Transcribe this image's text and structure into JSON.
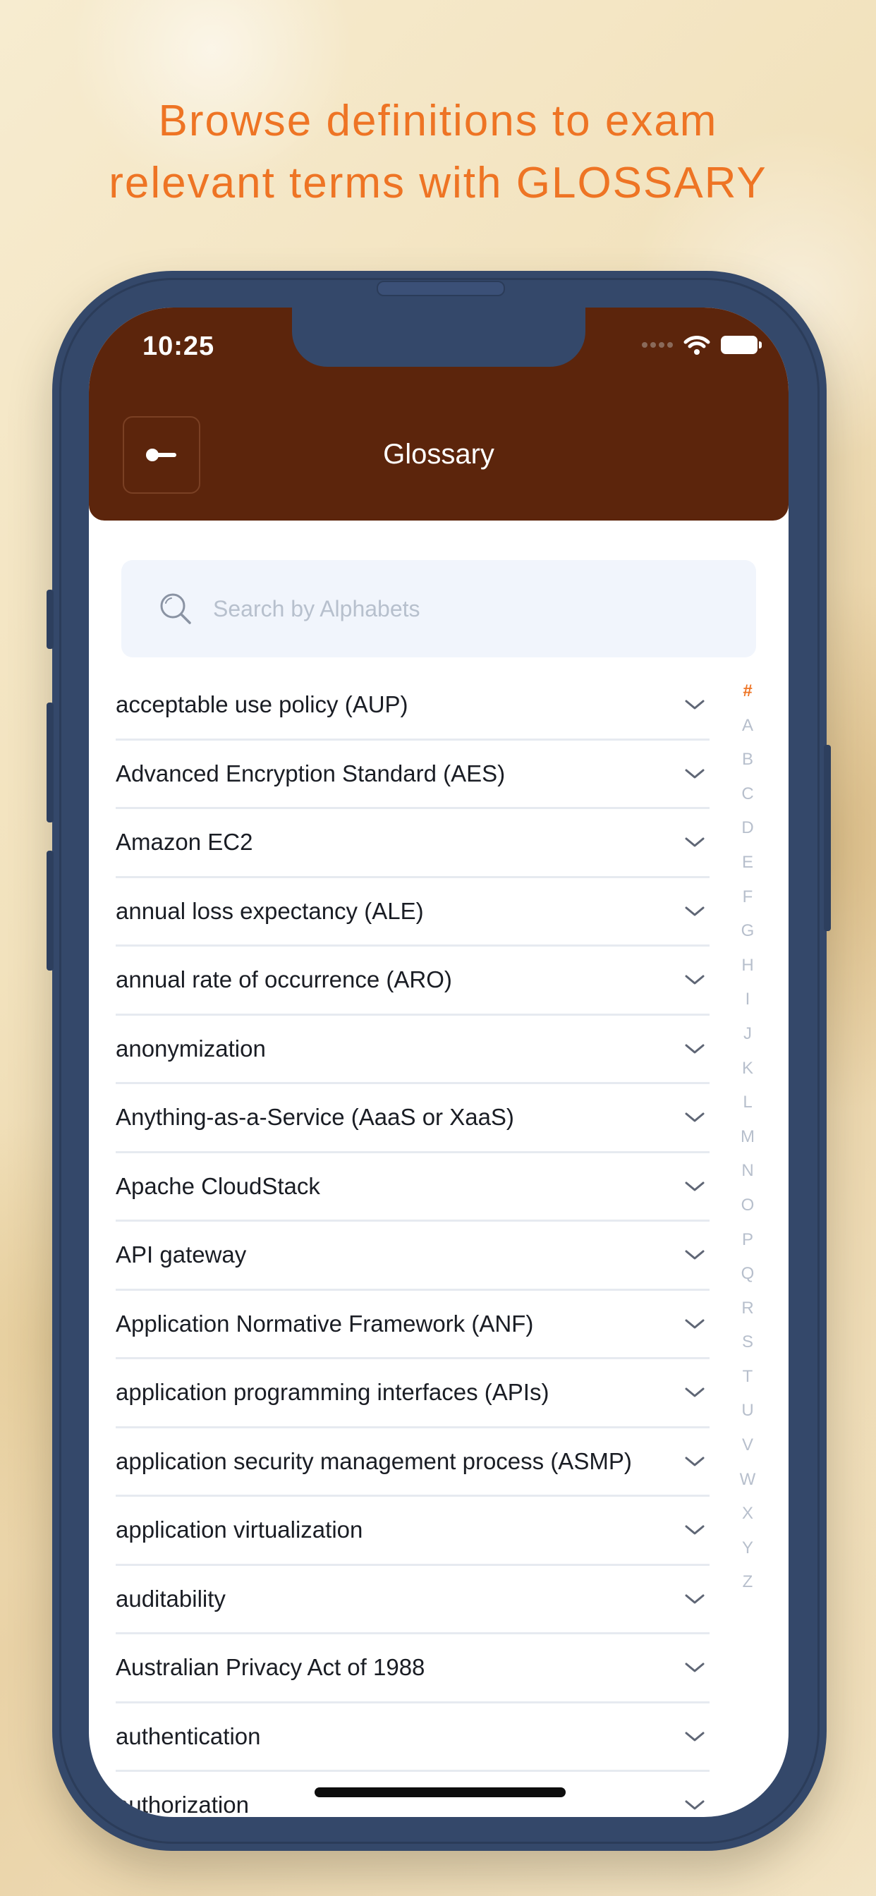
{
  "headline": {
    "line1": "Browse definitions to exam",
    "line2": "relevant terms with GLOSSARY"
  },
  "colors": {
    "accent": "#ee7424",
    "header_bg": "#5c250c",
    "phone_frame": "#34486a"
  },
  "status_bar": {
    "time": "10:25",
    "icons": [
      "cellular-signal-icon",
      "wifi-icon",
      "battery-icon"
    ]
  },
  "header": {
    "back_icon": "back-arrow-icon",
    "title": "Glossary"
  },
  "search": {
    "icon": "search-icon",
    "placeholder": "Search by Alphabets",
    "value": ""
  },
  "terms": [
    "acceptable use policy (AUP)",
    "Advanced Encryption Standard (AES)",
    "Amazon EC2",
    "annual loss expectancy (ALE)",
    "annual rate of occurrence (ARO)",
    "anonymization",
    "Anything-as-a-Service (AaaS or XaaS)",
    "Apache CloudStack",
    "API gateway",
    "Application Normative Framework (ANF)",
    "application programming interfaces (APIs)",
    "application security management process (ASMP)",
    "application virtualization",
    "auditability",
    "Australian Privacy Act of 1988",
    "authentication",
    "authorization"
  ],
  "alphabet_index": {
    "active": "#",
    "letters": [
      "#",
      "A",
      "B",
      "C",
      "D",
      "E",
      "F",
      "G",
      "H",
      "I",
      "J",
      "K",
      "L",
      "M",
      "N",
      "O",
      "P",
      "Q",
      "R",
      "S",
      "T",
      "U",
      "V",
      "W",
      "X",
      "Y",
      "Z"
    ]
  }
}
